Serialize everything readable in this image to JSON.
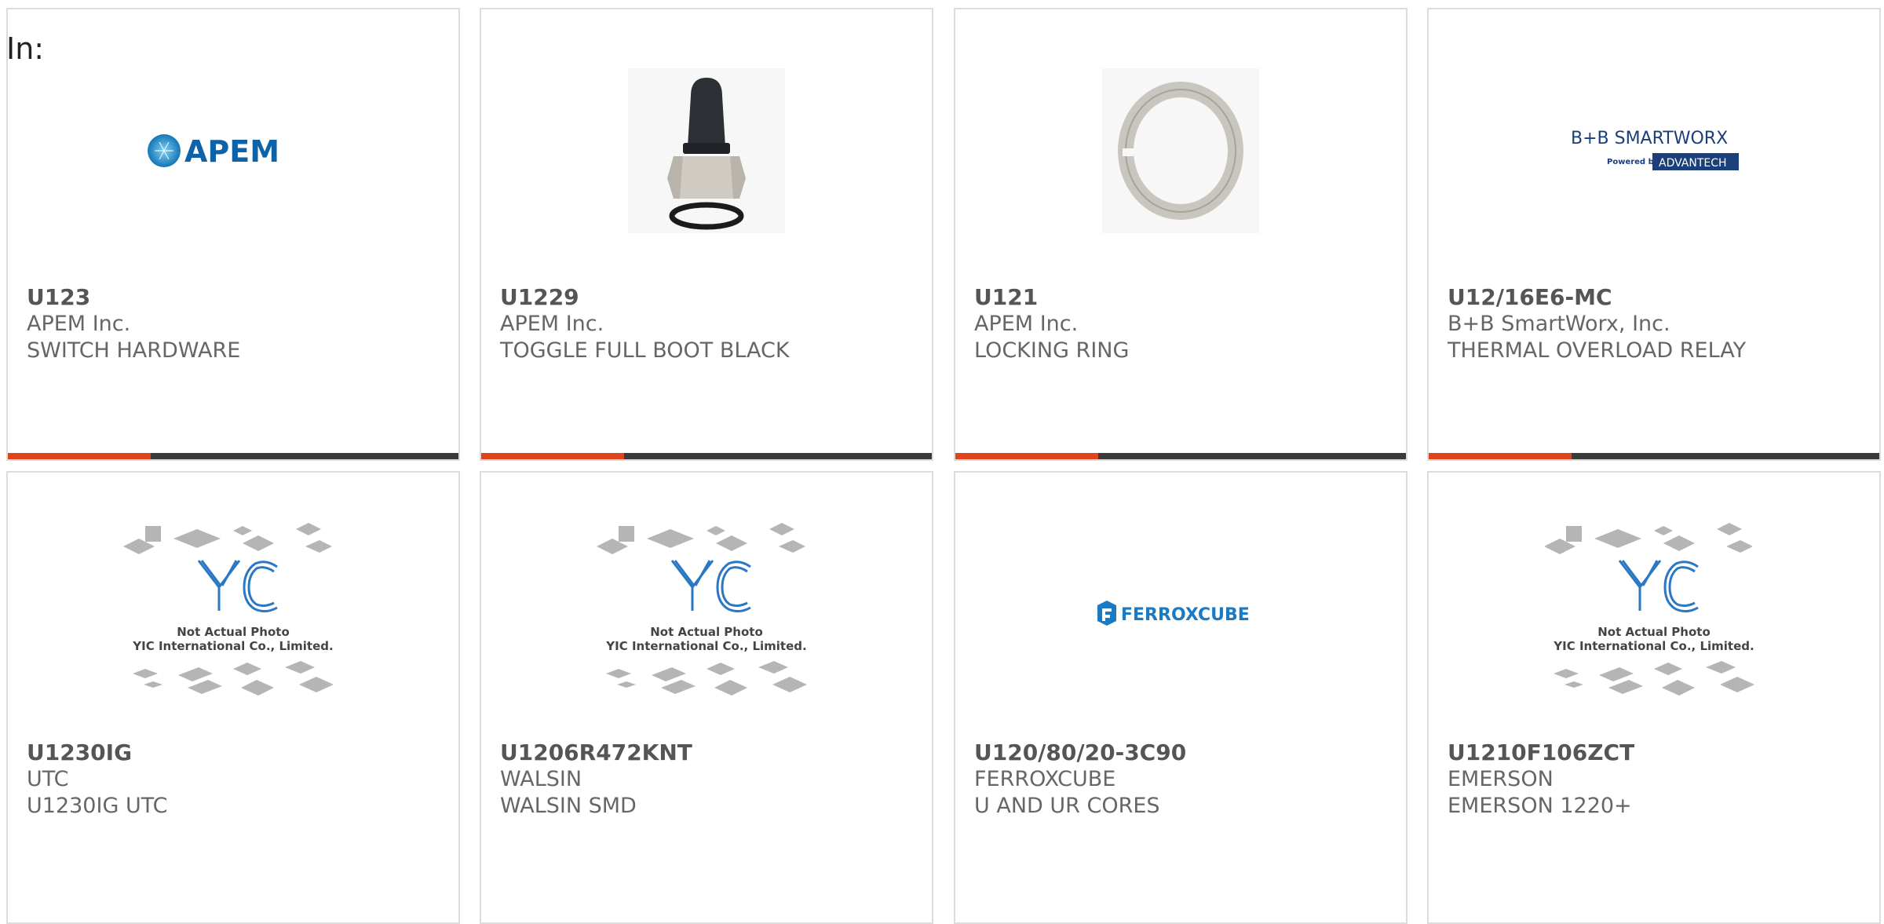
{
  "filter_label": "In:",
  "colors": {
    "accent": "#e0441c",
    "bar": "#3a3a3a",
    "border": "#dcdcdc"
  },
  "products": [
    {
      "part_number": "U123",
      "manufacturer": "APEM Inc.",
      "description": "SWITCH HARDWARE",
      "image": "apem-logo",
      "logo_text": "APEM"
    },
    {
      "part_number": "U1229",
      "manufacturer": "APEM Inc.",
      "description": "TOGGLE FULL BOOT BLACK",
      "image": "toggle-boot-photo"
    },
    {
      "part_number": "U121",
      "manufacturer": "APEM Inc.",
      "description": "LOCKING RING",
      "image": "locking-ring-photo"
    },
    {
      "part_number": "U12/16E6-MC",
      "manufacturer": "B+B SmartWorx, Inc.",
      "description": "THERMAL OVERLOAD RELAY",
      "image": "bb-smartworx-logo",
      "logo_text": "B+B SMARTWORX",
      "logo_sub": "Powered by",
      "logo_brand": "ADVANTECH"
    },
    {
      "part_number": "U1230IG",
      "manufacturer": "UTC",
      "description": "U1230IG UTC",
      "image": "yic-placeholder",
      "placeholder_line1": "Not Actual Photo",
      "placeholder_line2": "YIC International Co., Limited."
    },
    {
      "part_number": "U1206R472KNT",
      "manufacturer": "WALSIN",
      "description": "WALSIN SMD",
      "image": "yic-placeholder",
      "placeholder_line1": "Not Actual Photo",
      "placeholder_line2": "YIC International Co., Limited."
    },
    {
      "part_number": "U120/80/20-3C90",
      "manufacturer": "FERROXCUBE",
      "description": "U AND UR CORES",
      "image": "ferroxcube-logo",
      "logo_text": "FERROXCUBE"
    },
    {
      "part_number": "U1210F106ZCT",
      "manufacturer": "EMERSON",
      "description": "EMERSON 1220+",
      "image": "yic-placeholder",
      "placeholder_line1": "Not Actual Photo",
      "placeholder_line2": "YIC International Co., Limited."
    }
  ]
}
